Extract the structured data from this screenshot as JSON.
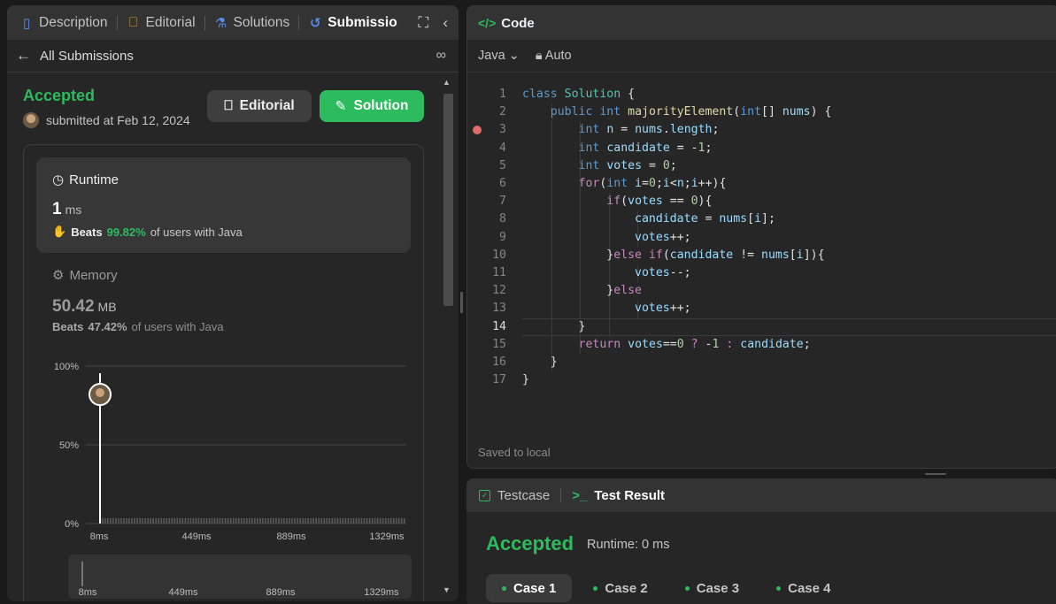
{
  "tabs": [
    {
      "label": "Description",
      "icon": "document-icon"
    },
    {
      "label": "Editorial",
      "icon": "book-icon"
    },
    {
      "label": "Solutions",
      "icon": "flask-icon"
    },
    {
      "label": "Submissio",
      "icon": "history-icon",
      "active": true
    }
  ],
  "subbar": {
    "back_label": "All Submissions"
  },
  "submission": {
    "status": "Accepted",
    "submitted": "submitted at Feb 12, 2024 2",
    "editorial_btn": "Editorial",
    "solution_btn": "Solution"
  },
  "runtime": {
    "title": "Runtime",
    "value": "1",
    "unit": "ms",
    "beats_label": "Beats",
    "beats_pct": "99.82%",
    "beats_suffix": "of users with Java"
  },
  "memory": {
    "title": "Memory",
    "value": "50.42",
    "unit": "MB",
    "beats_label": "Beats",
    "beats_pct": "47.42%",
    "beats_suffix": "of users with Java"
  },
  "chart_data": {
    "type": "bar",
    "y_ticks": [
      "100%",
      "50%",
      "0%"
    ],
    "x_ticks": [
      "8ms",
      "449ms",
      "889ms",
      "1329ms"
    ],
    "ylim": [
      0,
      100
    ],
    "marker_x": "8ms",
    "marker_percentile": 82
  },
  "mini_chart": {
    "x_ticks": [
      "8ms",
      "449ms",
      "889ms",
      "1329ms"
    ]
  },
  "code_panel": {
    "title": "Code",
    "language": "Java",
    "mode": "Auto",
    "saved": "Saved to local",
    "current_line": 14,
    "breakpoint_line": 3,
    "lines": [
      "class Solution {",
      "    public int majorityElement(int[] nums) {",
      "        int n = nums.length;",
      "        int candidate = -1;",
      "        int votes = 0;",
      "        for(int i=0;i<n;i++){",
      "            if(votes == 0){",
      "                candidate = nums[i];",
      "                votes++;",
      "            }else if(candidate != nums[i]){",
      "                votes--;",
      "            }else",
      "                votes++;",
      "        }",
      "        return votes==0 ? -1 : candidate;",
      "    }",
      "}"
    ]
  },
  "test_panel": {
    "testcase_tab": "Testcase",
    "result_tab": "Test Result",
    "status": "Accepted",
    "runtime": "Runtime: 0 ms",
    "cases": [
      "Case 1",
      "Case 2",
      "Case 3",
      "Case 4"
    ]
  },
  "colors": {
    "accent": "#2cbb5d",
    "panel": "#262626",
    "header": "#333333"
  }
}
